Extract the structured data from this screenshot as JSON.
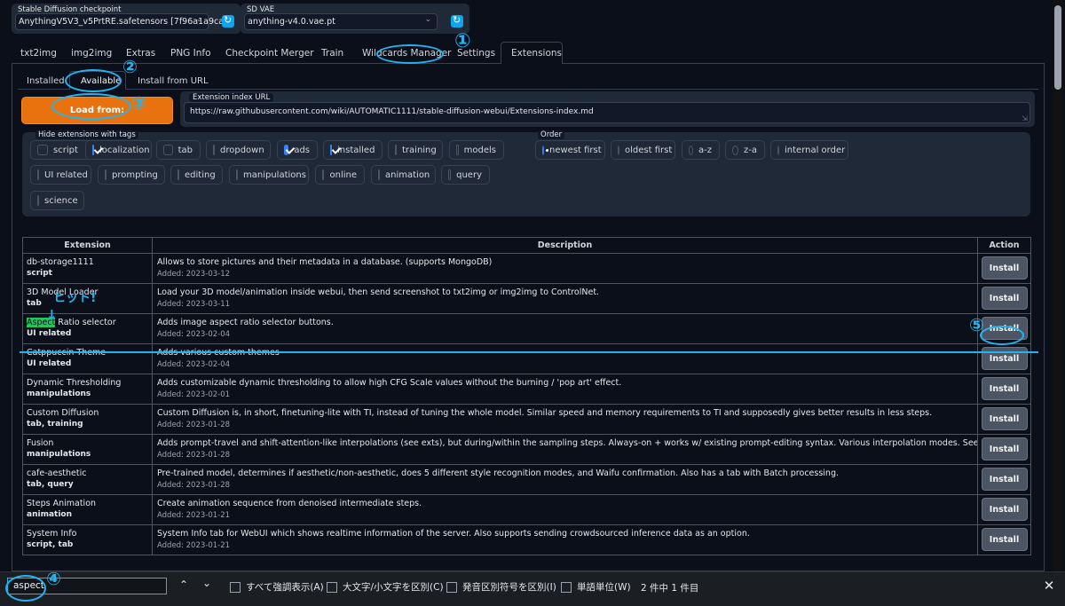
{
  "top": {
    "checkpoint_label": "Stable Diffusion checkpoint",
    "checkpoint_value": "AnythingV5V3_v5PrtRE.safetensors [7f96a1a9ca]",
    "vae_label": "SD VAE",
    "vae_value": "anything-v4.0.vae.pt"
  },
  "tabs": [
    "txt2img",
    "img2img",
    "Extras",
    "PNG Info",
    "Checkpoint Merger",
    "Train",
    "Wildcards Manager",
    "Settings",
    "Extensions"
  ],
  "subtabs": [
    "Installed",
    "Available",
    "Install from URL"
  ],
  "load_button": "Load from:",
  "index_url_label": "Extension index URL",
  "index_url": "https://raw.githubusercontent.com/wiki/AUTOMATIC1111/stable-diffusion-webui/Extensions-index.md",
  "hide_label": "Hide extensions with tags",
  "tags": [
    {
      "label": "script",
      "checked": false
    },
    {
      "label": "localization",
      "checked": true
    },
    {
      "label": "tab",
      "checked": false
    },
    {
      "label": "dropdown",
      "checked": false
    },
    {
      "label": "ads",
      "checked": true
    },
    {
      "label": "installed",
      "checked": true
    },
    {
      "label": "training",
      "checked": false
    },
    {
      "label": "models",
      "checked": false
    },
    {
      "label": "UI related",
      "checked": false
    },
    {
      "label": "prompting",
      "checked": false
    },
    {
      "label": "editing",
      "checked": false
    },
    {
      "label": "manipulations",
      "checked": false
    },
    {
      "label": "online",
      "checked": false
    },
    {
      "label": "animation",
      "checked": false
    },
    {
      "label": "query",
      "checked": false
    },
    {
      "label": "science",
      "checked": false
    }
  ],
  "order_label": "Order",
  "order": [
    {
      "label": "newest first",
      "selected": true
    },
    {
      "label": "oldest first",
      "selected": false
    },
    {
      "label": "a-z",
      "selected": false
    },
    {
      "label": "z-a",
      "selected": false
    },
    {
      "label": "internal order",
      "selected": false
    }
  ],
  "table": {
    "headers": [
      "Extension",
      "Description",
      "Action"
    ],
    "rows": [
      {
        "name": "db-storage1111",
        "tags": "script",
        "desc": "Allows to store pictures and their metadata in a database. (supports MongoDB)",
        "added": "Added: 2023-03-12",
        "action": "Install"
      },
      {
        "name": "3D Model Loader",
        "tags": "tab",
        "desc": "Load your 3D model/animation inside webui, then send screenshot to txt2img or img2img to ControlNet.",
        "added": "Added: 2023-03-11",
        "action": "Install"
      },
      {
        "name_hl": "Aspect",
        "name_rest": " Ratio selector",
        "tags": "UI related",
        "desc": "Adds image aspect ratio selector buttons.",
        "added": "Added: 2023-02-04",
        "action": "Install"
      },
      {
        "name": "Catppuccin Theme",
        "tags": "UI related",
        "desc": "Adds various custom themes",
        "added": "Added: 2023-02-04",
        "action": "Install"
      },
      {
        "name": "Dynamic Thresholding",
        "tags": "manipulations",
        "desc": "Adds customizable dynamic thresholding to allow high CFG Scale values without the burning / 'pop art' effect.",
        "added": "Added: 2023-02-01",
        "action": "Install"
      },
      {
        "name": "Custom Diffusion",
        "tags": "tab, training",
        "desc": "Custom Diffusion is, in short, finetuning-lite with TI, instead of tuning the whole model. Similar speed and memory requirements to TI and supposedly gives better results in less steps.",
        "added": "Added: 2023-01-28",
        "action": "Install"
      },
      {
        "name": "Fusion",
        "tags": "manipulations",
        "desc": "Adds prompt-travel and shift-attention-like interpolations (see exts), but during/within the sampling steps. Always-on + works w/ existing prompt-editing syntax. Various interpolation modes. See their wiki for more info.",
        "added": "Added: 2023-01-28",
        "action": "Install"
      },
      {
        "name": "cafe-aesthetic",
        "tags": "tab, query",
        "desc": "Pre-trained model, determines if aesthetic/non-aesthetic, does 5 different style recognition modes, and Waifu confirmation. Also has a tab with Batch processing.",
        "added": "Added: 2023-01-28",
        "action": "Install"
      },
      {
        "name": "Steps Animation",
        "tags": "animation",
        "desc": "Create animation sequence from denoised intermediate steps.",
        "added": "Added: 2023-01-21",
        "action": "Install"
      },
      {
        "name": "System Info",
        "tags": "script, tab",
        "desc": "System Info tab for WebUI which shows realtime information of the server. Also supports sending crowdsourced inference data as an option.",
        "added": "Added: 2023-01-21",
        "action": "Install"
      }
    ]
  },
  "findbar": {
    "query": "aspect",
    "options": [
      "すべて強調表示(A)",
      "大文字/小文字を区別(C)",
      "発音区別符号を区別(I)",
      "単語単位(W)"
    ],
    "count": "2 件中 1 件目"
  },
  "annotations": {
    "n1": "①",
    "n2": "②",
    "n3": "③",
    "n4": "④",
    "n5": "⑤",
    "hint": "ヒット!"
  }
}
